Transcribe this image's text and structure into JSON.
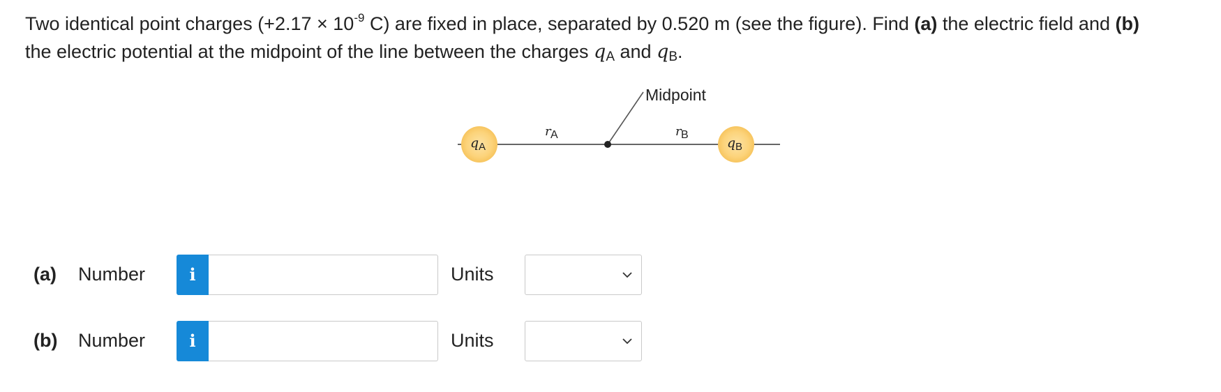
{
  "question": {
    "part1": "Two identical point charges (+2.17 × 10",
    "exponent": "-9",
    "part2": " C) are fixed in place, separated by 0.520 m (see the figure). Find ",
    "a_tag": "(a)",
    "part3": " the electric field and ",
    "b_tag": "(b)",
    "part4": " the electric potential at the midpoint of the line between the charges ",
    "qA_sym": "q",
    "qA_sub": "A",
    "and_word": " and ",
    "qB_sym": "q",
    "qB_sub": "B",
    "end": "."
  },
  "figure": {
    "midpoint_label": "Midpoint",
    "rA_sym": "r",
    "rA_sub": "A",
    "rB_sym": "r",
    "rB_sub": "B",
    "qA_sym": "q",
    "qA_sub": "A",
    "qB_sym": "q",
    "qB_sub": "B"
  },
  "answers": [
    {
      "part_label": "(a)",
      "number_label": "Number",
      "info_glyph": "i",
      "value": "",
      "units_label": "Units",
      "units_selected": ""
    },
    {
      "part_label": "(b)",
      "number_label": "Number",
      "info_glyph": "i",
      "value": "",
      "units_label": "Units",
      "units_selected": ""
    }
  ],
  "icons": {
    "info": "info-icon",
    "dropdown": "chevron-down-icon"
  },
  "colors": {
    "info_button": "#1689d8",
    "charge_fill": "#fcd37a",
    "line": "#333333"
  }
}
